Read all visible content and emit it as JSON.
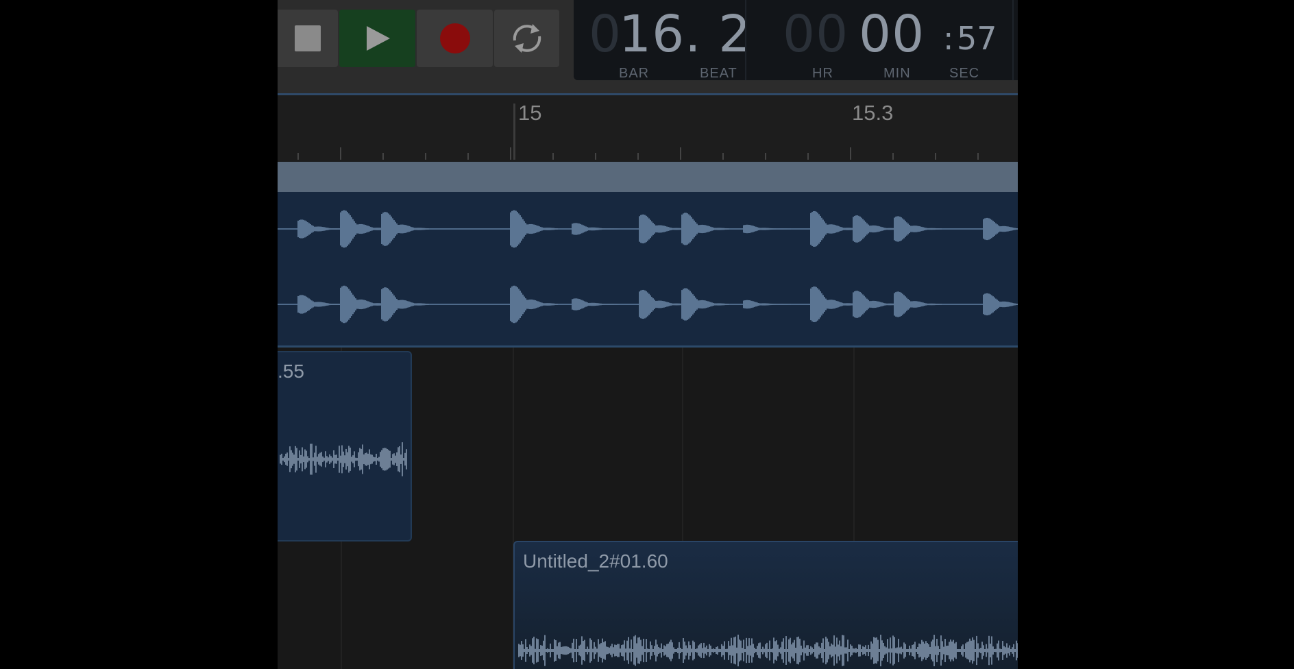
{
  "transport": {
    "stop_icon": "stop-icon",
    "play_icon": "play-icon",
    "record_icon": "record-icon",
    "cycle_icon": "cycle-icon",
    "play_active_color": "#16401f",
    "record_color": "#8a0c0c"
  },
  "lcd": {
    "bar_digits_dim": "0",
    "bar_beat_value": "16. 2",
    "bar_label": "BAR",
    "beat_label": "BEAT",
    "hour_digits_dim": "00",
    "min_value": "00",
    "colon": ":",
    "sec_value": "57",
    "hr_label": "HR",
    "min_label": "MIN",
    "sec_label": "SEC",
    "dropdown_icon": "chevron-down-icon"
  },
  "ruler": {
    "markers": [
      "15",
      "15.3"
    ]
  },
  "regions": [
    {
      "label": ""
    },
    {
      "label": ".55"
    },
    {
      "label": "Untitled_2#01.60"
    }
  ]
}
